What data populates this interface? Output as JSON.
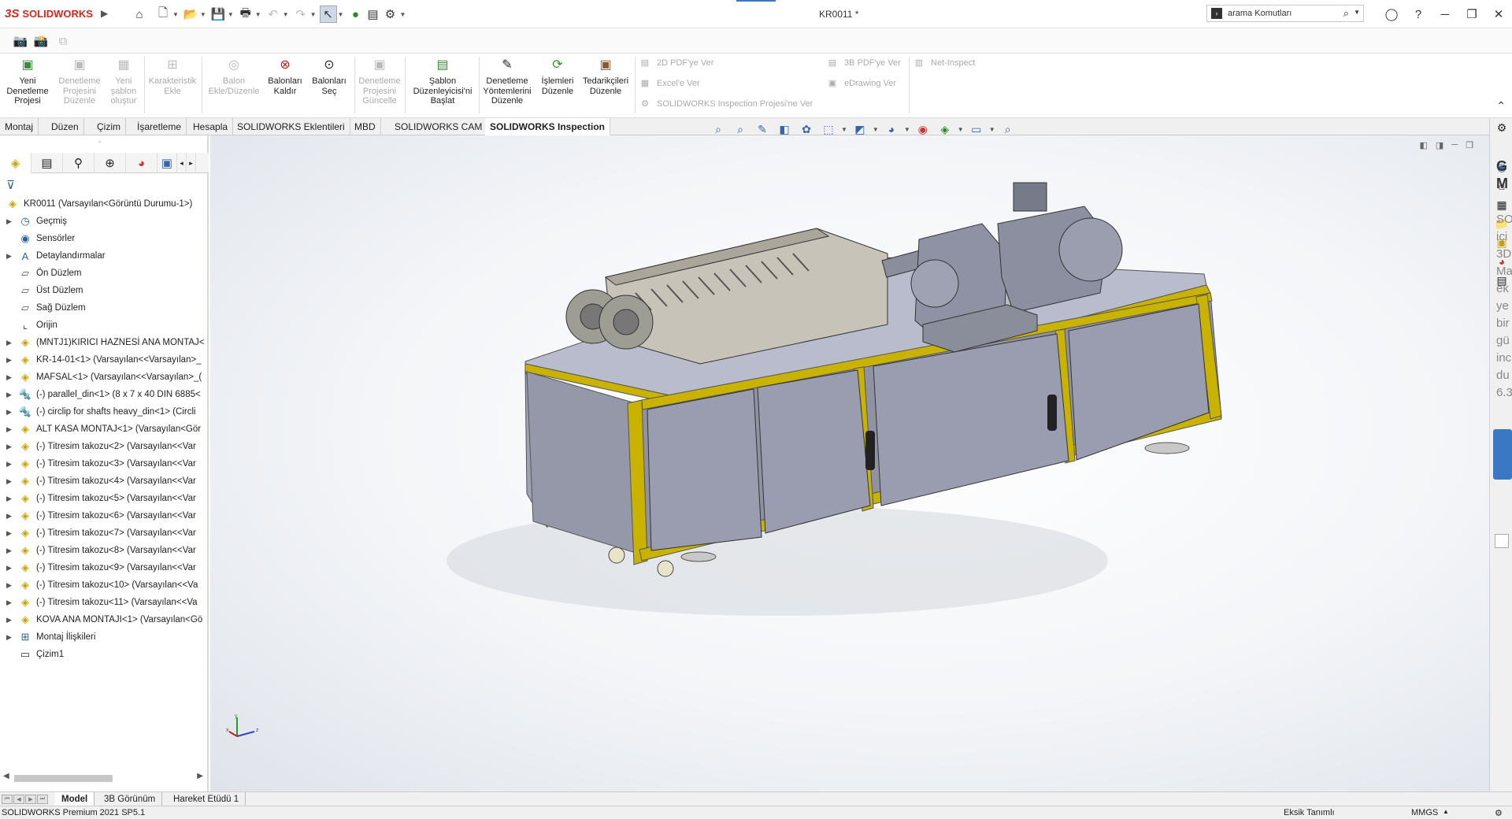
{
  "app": {
    "brand_ds": "3S",
    "brand_name": "SOLIDWORKS",
    "doc_title": "KR0011 *"
  },
  "search": {
    "placeholder": "arama Komutları"
  },
  "ribbon": {
    "buttons": [
      {
        "label": "Yeni Denetleme Projesi",
        "enabled": true,
        "icon": "new-inspection-icon"
      },
      {
        "label": "Denetleme Projesini Düzenle",
        "enabled": false,
        "icon": "edit-inspection-icon"
      },
      {
        "label": "Yeni şablon oluştur",
        "enabled": false,
        "icon": "new-template-icon"
      },
      {
        "label": "Karakteristik Ekle",
        "enabled": false,
        "icon": "add-characteristic-icon"
      },
      {
        "label": "Balon Ekle/Düzenle",
        "enabled": false,
        "icon": "balloon-edit-icon"
      },
      {
        "label": "Balonları Kaldır",
        "enabled": true,
        "icon": "remove-balloons-icon"
      },
      {
        "label": "Balonları Seç",
        "enabled": true,
        "icon": "select-balloons-icon"
      },
      {
        "label": "Denetleme Projesini Güncelle",
        "enabled": false,
        "icon": "update-inspection-icon"
      },
      {
        "label": "Şablon Düzenleyicisi'ni Başlat",
        "enabled": true,
        "icon": "template-editor-icon"
      },
      {
        "label": "Denetleme Yöntemlerini Düzenle",
        "enabled": true,
        "icon": "inspection-methods-icon"
      },
      {
        "label": "İşlemleri Düzenle",
        "enabled": true,
        "icon": "operations-icon"
      },
      {
        "label": "Tedarikçileri Düzenle",
        "enabled": true,
        "icon": "vendors-icon"
      }
    ],
    "export": {
      "pdf2d": "2D PDF'ye Ver",
      "excel": "Excel'e Ver",
      "sw_project": "SOLIDWORKS Inspection Projesi'ne Ver",
      "pdf3d": "3B PDF'ye Ver",
      "edrawing": "eDrawing Ver",
      "net_inspect": "Net-Inspect"
    }
  },
  "tabs": [
    {
      "label": "Montaj",
      "active": false
    },
    {
      "label": "Düzen",
      "active": false
    },
    {
      "label": "Çizim",
      "active": false
    },
    {
      "label": "İşaretleme",
      "active": false
    },
    {
      "label": "Hesapla",
      "active": false
    },
    {
      "label": "SOLIDWORKS Eklentileri",
      "active": false
    },
    {
      "label": "MBD",
      "active": false
    },
    {
      "label": "SOLIDWORKS CAM",
      "active": false
    },
    {
      "label": "SOLIDWORKS Inspection",
      "active": true
    }
  ],
  "tree": [
    {
      "label": "KR0011  (Varsayılan<Görüntü Durumu-1>)",
      "icon": "assembly-icon",
      "expand": false,
      "root": true
    },
    {
      "label": "Geçmiş",
      "icon": "history-icon",
      "expand": true
    },
    {
      "label": "Sensörler",
      "icon": "sensor-icon",
      "expand": false
    },
    {
      "label": "Detaylandırmalar",
      "icon": "annotation-icon",
      "expand": true
    },
    {
      "label": "Ön Düzlem",
      "icon": "plane-icon",
      "expand": false
    },
    {
      "label": "Üst Düzlem",
      "icon": "plane-icon",
      "expand": false
    },
    {
      "label": "Sağ Düzlem",
      "icon": "plane-icon",
      "expand": false
    },
    {
      "label": "Orijin",
      "icon": "origin-icon",
      "expand": false
    },
    {
      "label": "(MNTJ1)KIRICI HAZNESİ ANA MONTAJ<",
      "icon": "subassembly-icon",
      "expand": true
    },
    {
      "label": "KR-14-01<1> (Varsayılan<<Varsayılan>_",
      "icon": "subassembly-icon",
      "expand": true
    },
    {
      "label": "MAFSAL<1> (Varsayılan<<Varsayılan>_(",
      "icon": "subassembly-icon",
      "expand": true
    },
    {
      "label": "(-) parallel_din<1> (8 x 7 x 40 DIN 6885<",
      "icon": "toolbox-part-icon",
      "expand": true
    },
    {
      "label": "(-) circlip for shafts heavy_din<1> (Circli",
      "icon": "toolbox-part-icon",
      "expand": true
    },
    {
      "label": "ALT KASA MONTAJ<1> (Varsayılan<Gör",
      "icon": "subassembly-icon",
      "expand": true
    },
    {
      "label": "(-) Titresim takozu<2> (Varsayılan<<Var",
      "icon": "subassembly-icon",
      "expand": true
    },
    {
      "label": "(-) Titresim takozu<3> (Varsayılan<<Var",
      "icon": "subassembly-icon",
      "expand": true
    },
    {
      "label": "(-) Titresim takozu<4> (Varsayılan<<Var",
      "icon": "subassembly-icon",
      "expand": true
    },
    {
      "label": "(-) Titresim takozu<5> (Varsayılan<<Var",
      "icon": "subassembly-icon",
      "expand": true
    },
    {
      "label": "(-) Titresim takozu<6> (Varsayılan<<Var",
      "icon": "subassembly-icon",
      "expand": true
    },
    {
      "label": "(-) Titresim takozu<7> (Varsayılan<<Var",
      "icon": "subassembly-icon",
      "expand": true
    },
    {
      "label": "(-) Titresim takozu<8> (Varsayılan<<Var",
      "icon": "subassembly-icon",
      "expand": true
    },
    {
      "label": "(-) Titresim takozu<9> (Varsayılan<<Var",
      "icon": "subassembly-icon",
      "expand": true
    },
    {
      "label": "(-) Titresim takozu<10> (Varsayılan<<Va",
      "icon": "subassembly-icon",
      "expand": true
    },
    {
      "label": "(-) Titresim takozu<11> (Varsayılan<<Va",
      "icon": "subassembly-icon",
      "expand": true
    },
    {
      "label": "KOVA ANA MONTAJI<1> (Varsayılan<Gö",
      "icon": "subassembly-icon",
      "expand": true
    },
    {
      "label": "Montaj İlişkileri",
      "icon": "mates-icon",
      "expand": true
    },
    {
      "label": "Çizim1",
      "icon": "sketch-icon",
      "expand": false
    }
  ],
  "taskpane": {
    "heading": "G\nM",
    "text": "SO\niçi\n3D\nMa\nek\nye\nbir\ngü\ninc\ndu\n6.3"
  },
  "bottom_tabs": [
    {
      "label": "Model",
      "active": true
    },
    {
      "label": "3B Görünüm",
      "active": false
    },
    {
      "label": "Hareket Etüdü 1",
      "active": false
    }
  ],
  "status": {
    "version": "SOLIDWORKS Premium 2021 SP5.1",
    "definition": "Eksik Tanımlı",
    "units": "MMGS"
  },
  "colors": {
    "accent": "#3b78c4",
    "brand": "#d1281e",
    "frame_yellow": "#c9b200",
    "cabinet": "#8f92a4"
  }
}
